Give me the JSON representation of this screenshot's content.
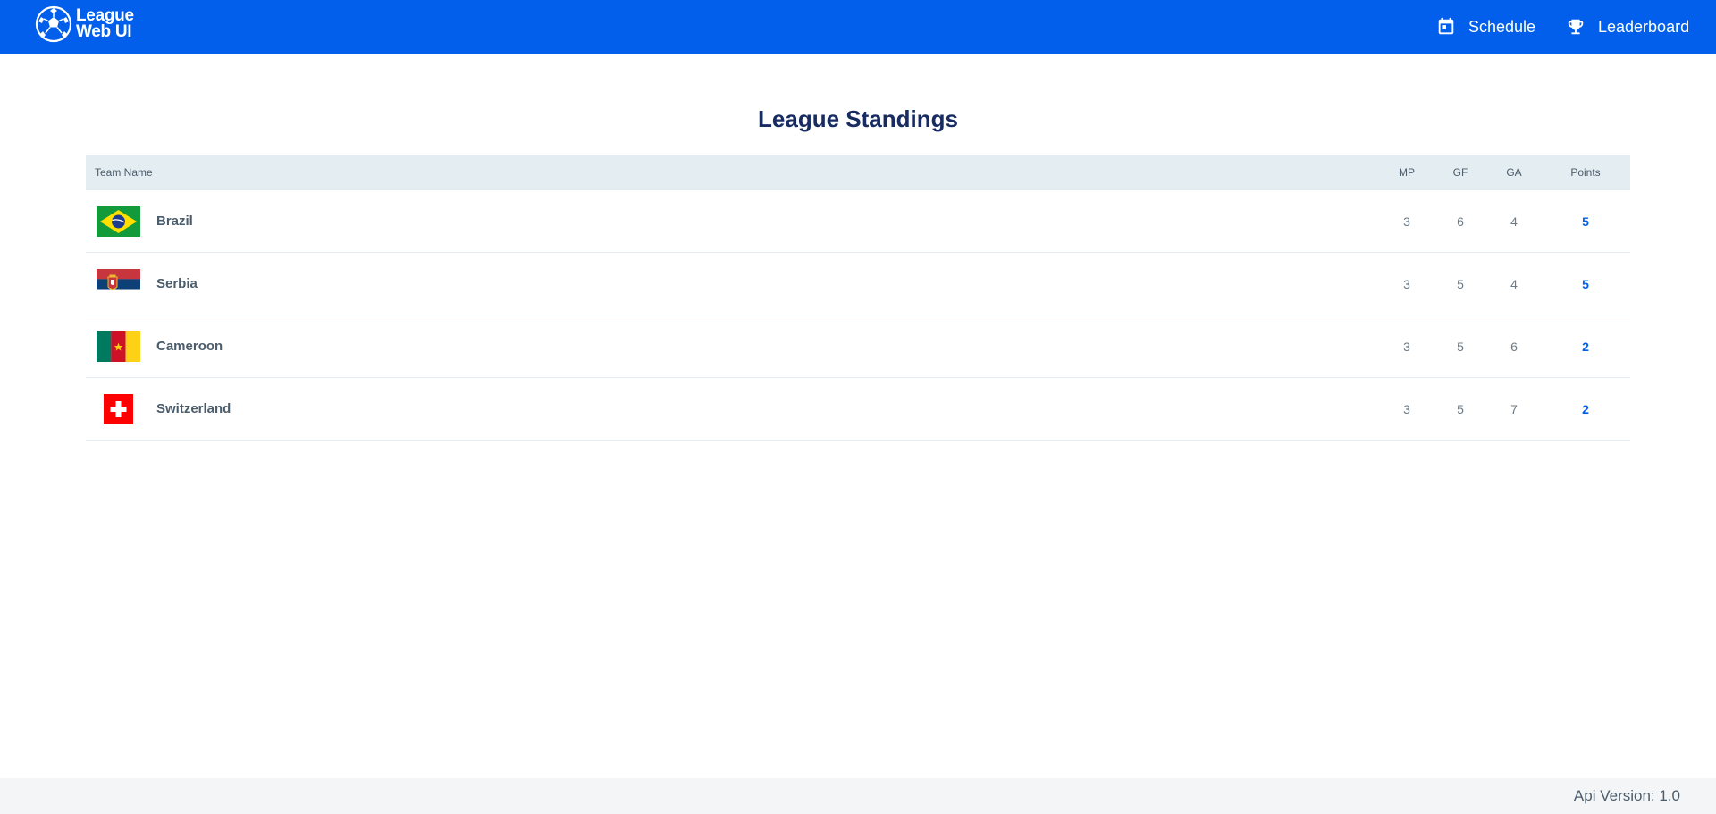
{
  "header": {
    "logo_line1": "League",
    "logo_line2": "Web UI",
    "nav": [
      {
        "label": "Schedule",
        "icon": "calendar-icon"
      },
      {
        "label": "Leaderboard",
        "icon": "trophy-icon"
      }
    ],
    "background": "#025feb"
  },
  "main": {
    "title": "League Standings",
    "columns": {
      "team": "Team Name",
      "mp": "MP",
      "gf": "GF",
      "ga": "GA",
      "points": "Points"
    },
    "rows": [
      {
        "team": "Brazil",
        "flag": "brazil-flag-icon",
        "mp": "3",
        "gf": "6",
        "ga": "4",
        "points": "5"
      },
      {
        "team": "Serbia",
        "flag": "serbia-flag-icon",
        "mp": "3",
        "gf": "5",
        "ga": "4",
        "points": "5"
      },
      {
        "team": "Cameroon",
        "flag": "cameroon-flag-icon",
        "mp": "3",
        "gf": "5",
        "ga": "6",
        "points": "2"
      },
      {
        "team": "Switzerland",
        "flag": "switzerland-flag-icon",
        "mp": "3",
        "gf": "5",
        "ga": "7",
        "points": "2"
      }
    ]
  },
  "footer": {
    "version": "Api Version: 1.0"
  },
  "colors": {
    "accent": "#025feb",
    "title": "#182c62",
    "table_header_bg": "#e4edf2",
    "footer_bg": "#f4f5f6"
  }
}
